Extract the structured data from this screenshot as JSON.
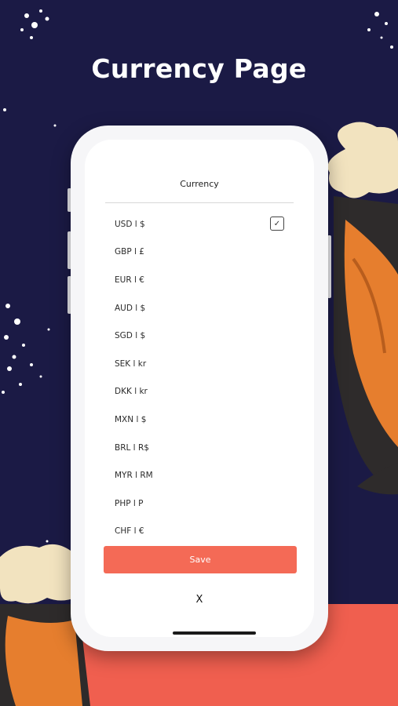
{
  "page": {
    "headline": "Currency Page"
  },
  "colors": {
    "background": "#1b1a45",
    "accent_band": "#f05f4f",
    "save_button": "#f46a56"
  },
  "currency_sheet": {
    "title": "Currency",
    "items": [
      {
        "label": "USD l $",
        "selected": true
      },
      {
        "label": "GBP l £",
        "selected": false
      },
      {
        "label": "EUR l €",
        "selected": false
      },
      {
        "label": "AUD l $",
        "selected": false
      },
      {
        "label": "SGD l $",
        "selected": false
      },
      {
        "label": "SEK l kr",
        "selected": false
      },
      {
        "label": "DKK l kr",
        "selected": false
      },
      {
        "label": "MXN l $",
        "selected": false
      },
      {
        "label": "BRL l R$",
        "selected": false
      },
      {
        "label": "MYR l RM",
        "selected": false
      },
      {
        "label": "PHP l P",
        "selected": false
      },
      {
        "label": "CHF l €",
        "selected": false
      }
    ],
    "check_icon": "checkmark-icon",
    "save_label": "Save",
    "close_label": "X"
  }
}
